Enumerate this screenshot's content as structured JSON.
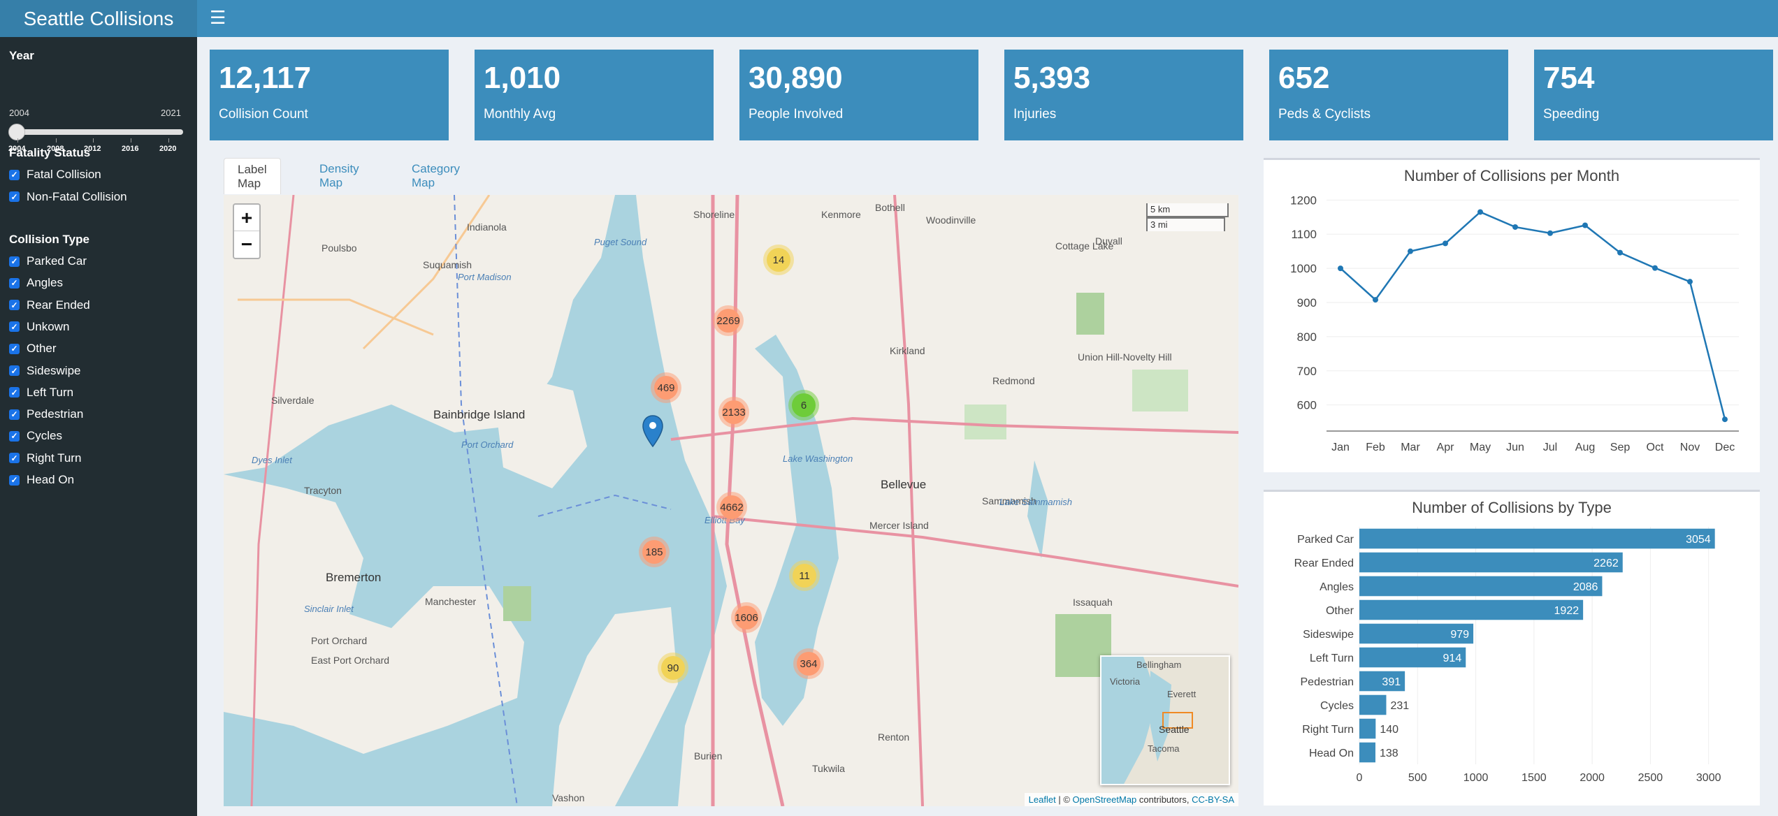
{
  "app": {
    "title": "Seattle Collisions",
    "menu_icon": "hamburger-icon"
  },
  "sidebar": {
    "year": {
      "title": "Year",
      "min": "2004",
      "max": "2021",
      "selected": "2004",
      "ticks": [
        "2004",
        "2008",
        "2012",
        "2016",
        "2020"
      ]
    },
    "fatality": {
      "title": "Fatality Status",
      "items": [
        {
          "label": "Fatal Collision",
          "checked": true
        },
        {
          "label": "Non-Fatal Collision",
          "checked": true
        }
      ]
    },
    "collision_type": {
      "title": "Collision Type",
      "items": [
        {
          "label": "Parked Car",
          "checked": true
        },
        {
          "label": "Angles",
          "checked": true
        },
        {
          "label": "Rear Ended",
          "checked": true
        },
        {
          "label": "Unkown",
          "checked": true
        },
        {
          "label": "Other",
          "checked": true
        },
        {
          "label": "Sideswipe",
          "checked": true
        },
        {
          "label": "Left Turn",
          "checked": true
        },
        {
          "label": "Pedestrian",
          "checked": true
        },
        {
          "label": "Cycles",
          "checked": true
        },
        {
          "label": "Right Turn",
          "checked": true
        },
        {
          "label": "Head On",
          "checked": true
        }
      ]
    }
  },
  "value_boxes": [
    {
      "value": "12,117",
      "label": "Collision Count"
    },
    {
      "value": "1,010",
      "label": "Monthly Avg"
    },
    {
      "value": "30,890",
      "label": "People Involved"
    },
    {
      "value": "5,393",
      "label": "Injuries"
    },
    {
      "value": "652",
      "label": "Peds & Cyclists"
    },
    {
      "value": "754",
      "label": "Speeding"
    }
  ],
  "tabs": [
    {
      "label": "Label Map",
      "active": true
    },
    {
      "label": "Density Map",
      "active": false
    },
    {
      "label": "Category Map",
      "active": false
    }
  ],
  "map": {
    "zoom_in": "+",
    "zoom_out": "−",
    "scale_km": "5 km",
    "scale_mi": "3 mi",
    "attribution": {
      "leaflet": "Leaflet",
      "sep": " | © ",
      "osm": "OpenStreetMap",
      "contributors": " contributors, ",
      "license": "CC-BY-SA"
    },
    "clusters": [
      "14",
      "2269",
      "469",
      "2133",
      "6",
      "4662",
      "185",
      "11",
      "1606",
      "364",
      "90"
    ],
    "place_labels": [
      "Shoreline",
      "Kenmore",
      "Bothell",
      "Woodinville",
      "Indianola",
      "Poulsbo",
      "Suquamish",
      "Port Madison",
      "Cottage Lake",
      "Duvall",
      "Kirkland",
      "Redmond",
      "Union Hill-Novelty Hill",
      "Silverdale",
      "Bainbridge Island",
      "Bellevue",
      "Sammamish",
      "Tracyton",
      "Bremerton",
      "Manchester",
      "Mercer Island",
      "Port Orchard",
      "East Port Orchard",
      "Issaquah",
      "Burien",
      "Renton",
      "Tukwila",
      "Vashon",
      "Lake Washington",
      "Lake Sammamish",
      "Puget Sound",
      "Dyes Inlet",
      "Elliott Bay",
      "Sinclair Inlet",
      "Port Orchard"
    ],
    "minimap_labels": [
      "Bellingham",
      "Victoria",
      "Everett",
      "Seattle",
      "Tacoma"
    ]
  },
  "colors": {
    "primary": "#3c8dbc",
    "logo": "#367fa9",
    "sidebar": "#222d32",
    "line": "#1f77b4",
    "bar": "#3c8dbc",
    "cluster_small": "#f1d357",
    "cluster_medium": "#fd9c73",
    "cluster_green": "#6ecc39"
  },
  "chart_data": [
    {
      "type": "line",
      "title": "Number of Collisions per Month",
      "categories": [
        "Jan",
        "Feb",
        "Mar",
        "Apr",
        "May",
        "Jun",
        "Jul",
        "Aug",
        "Sep",
        "Oct",
        "Nov",
        "Dec"
      ],
      "values": [
        1000,
        908,
        1050,
        1073,
        1165,
        1121,
        1103,
        1126,
        1046,
        1001,
        961,
        558
      ],
      "yticks": [
        600,
        700,
        800,
        900,
        1000,
        1100,
        1200
      ],
      "ylim": [
        540,
        1215
      ],
      "grid": true
    },
    {
      "type": "bar",
      "orientation": "horizontal",
      "title": "Number of Collisions by Type",
      "categories": [
        "Parked Car",
        "Rear Ended",
        "Angles",
        "Other",
        "Sideswipe",
        "Left Turn",
        "Pedestrian",
        "Cycles",
        "Right Turn",
        "Head On"
      ],
      "values": [
        3054,
        2262,
        2086,
        1922,
        979,
        914,
        391,
        231,
        140,
        138
      ],
      "xticks": [
        0,
        500,
        1000,
        1500,
        2000,
        2500,
        3000
      ],
      "xlim": [
        0,
        3200
      ],
      "grid": true
    }
  ]
}
